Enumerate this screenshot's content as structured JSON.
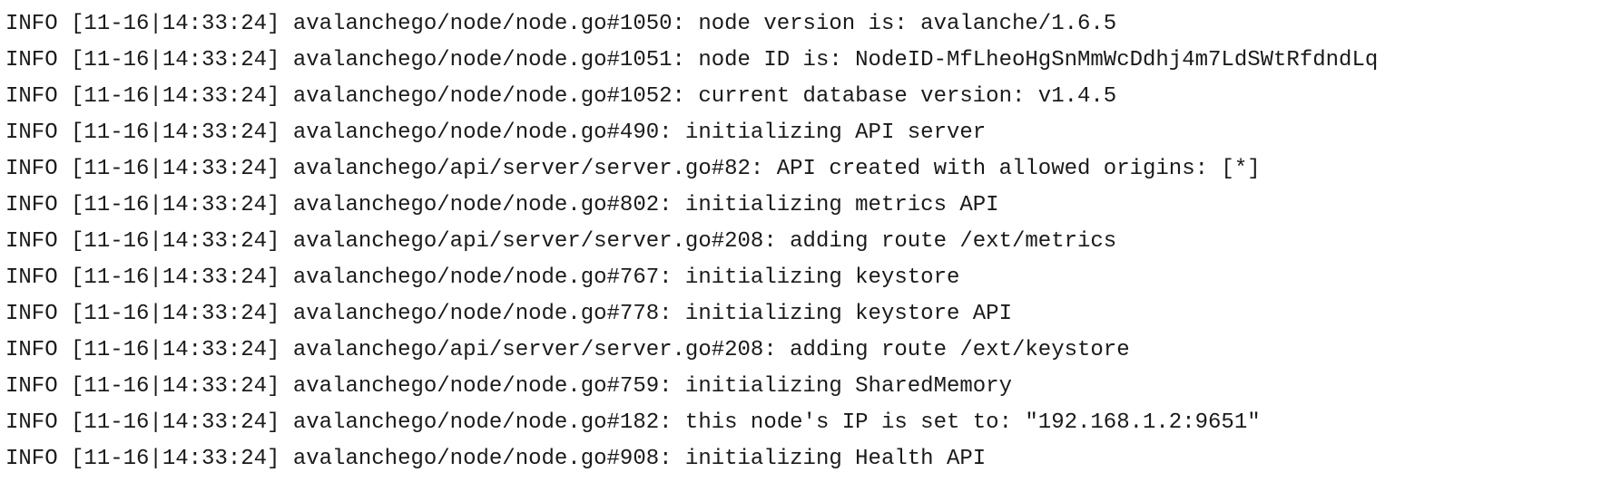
{
  "log": {
    "lines": [
      "INFO [11-16|14:33:24] avalanchego/node/node.go#1050: node version is: avalanche/1.6.5",
      "INFO [11-16|14:33:24] avalanchego/node/node.go#1051: node ID is: NodeID-MfLheoHgSnMmWcDdhj4m7LdSWtRfdndLq",
      "INFO [11-16|14:33:24] avalanchego/node/node.go#1052: current database version: v1.4.5",
      "INFO [11-16|14:33:24] avalanchego/node/node.go#490: initializing API server",
      "INFO [11-16|14:33:24] avalanchego/api/server/server.go#82: API created with allowed origins: [*]",
      "INFO [11-16|14:33:24] avalanchego/node/node.go#802: initializing metrics API",
      "INFO [11-16|14:33:24] avalanchego/api/server/server.go#208: adding route /ext/metrics",
      "INFO [11-16|14:33:24] avalanchego/node/node.go#767: initializing keystore",
      "INFO [11-16|14:33:24] avalanchego/node/node.go#778: initializing keystore API",
      "INFO [11-16|14:33:24] avalanchego/api/server/server.go#208: adding route /ext/keystore",
      "INFO [11-16|14:33:24] avalanchego/node/node.go#759: initializing SharedMemory",
      "INFO [11-16|14:33:24] avalanchego/node/node.go#182: this node's IP is set to: \"192.168.1.2:9651\"",
      "INFO [11-16|14:33:24] avalanchego/node/node.go#908: initializing Health API"
    ]
  }
}
